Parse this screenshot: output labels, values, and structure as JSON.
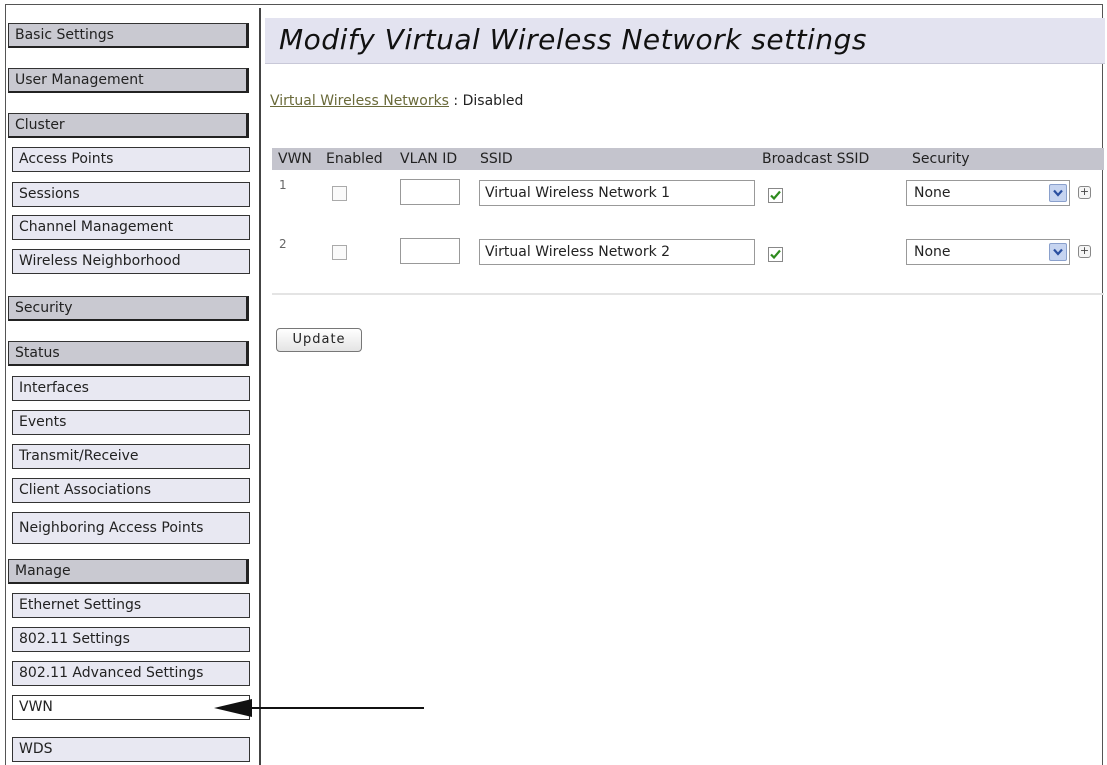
{
  "sidebar": {
    "items": [
      {
        "label": "Basic Settings"
      },
      {
        "label": "User Management"
      },
      {
        "label": "Cluster"
      },
      {
        "label": "Access Points"
      },
      {
        "label": "Sessions"
      },
      {
        "label": "Channel Management"
      },
      {
        "label": "Wireless Neighborhood"
      },
      {
        "label": "Security"
      },
      {
        "label": "Status"
      },
      {
        "label": "Interfaces"
      },
      {
        "label": "Events"
      },
      {
        "label": "Transmit/Receive"
      },
      {
        "label": "Client Associations"
      },
      {
        "label": "Neighboring Access Points"
      },
      {
        "label": "Manage"
      },
      {
        "label": "Ethernet Settings"
      },
      {
        "label": "802.11 Settings"
      },
      {
        "label": "802.11 Advanced Settings"
      },
      {
        "label": "VWN"
      },
      {
        "label": "WDS"
      }
    ],
    "selected": "VWN"
  },
  "main": {
    "title": "Modify Virtual Wireless Network settings",
    "status_link": "Virtual Wireless Networks",
    "status_sep": " : ",
    "status_value": "Disabled",
    "table": {
      "headers": {
        "vwn": "VWN",
        "enabled": "Enabled",
        "vlan": "VLAN ID",
        "ssid": "SSID",
        "broadcast": "Broadcast SSID",
        "security": "Security"
      },
      "rows": [
        {
          "num": "1",
          "enabled": false,
          "vlan": "",
          "ssid": "Virtual Wireless Network 1",
          "broadcast": true,
          "security": "None"
        },
        {
          "num": "2",
          "enabled": false,
          "vlan": "",
          "ssid": "Virtual Wireless Network 2",
          "broadcast": true,
          "security": "None"
        }
      ]
    },
    "update_label": "Update",
    "plus_symbol": "+"
  },
  "colors": {
    "section_bg": "#c9c9d1",
    "subitem_bg": "#e8e8f2",
    "title_bg": "#e3e3f0",
    "header_bg": "#c4c4cd",
    "link": "#6a6a3a",
    "check": "#2e8b1e"
  },
  "icons": {
    "checkmark": "checkmark-icon",
    "dropdown": "chevron-down-icon",
    "add": "plus-icon",
    "pointer": "left-arrow-icon"
  }
}
